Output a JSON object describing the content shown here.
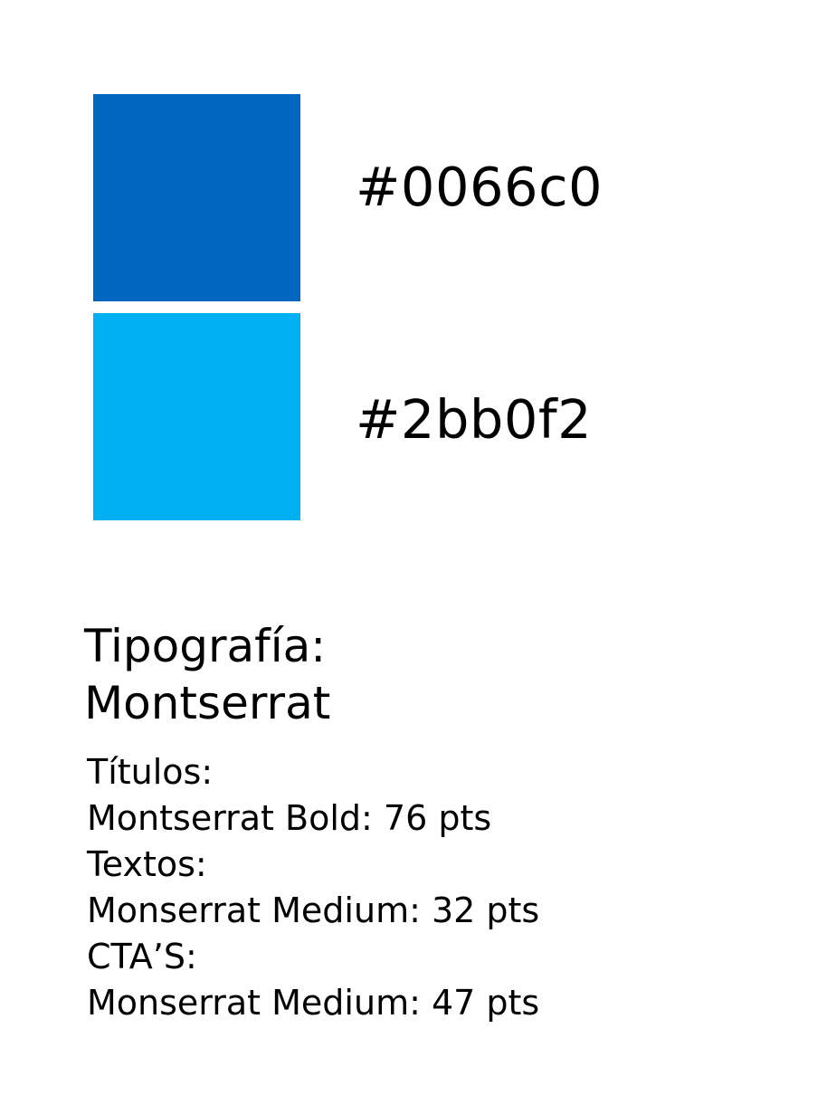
{
  "palette": {
    "colors": [
      {
        "hex": "#0066c0",
        "label": "#0066c0"
      },
      {
        "hex": "#00b0f2",
        "label": "#2bb0f2"
      }
    ]
  },
  "typography": {
    "heading_line_1": "Tipografía:",
    "heading_line_2": "Montserrat",
    "specs": [
      "Títulos:",
      "Montserrat Bold: 76 pts",
      "Textos:",
      "Monserrat Medium: 32 pts",
      "CTA’S:",
      "Monserrat Medium: 47 pts"
    ]
  }
}
